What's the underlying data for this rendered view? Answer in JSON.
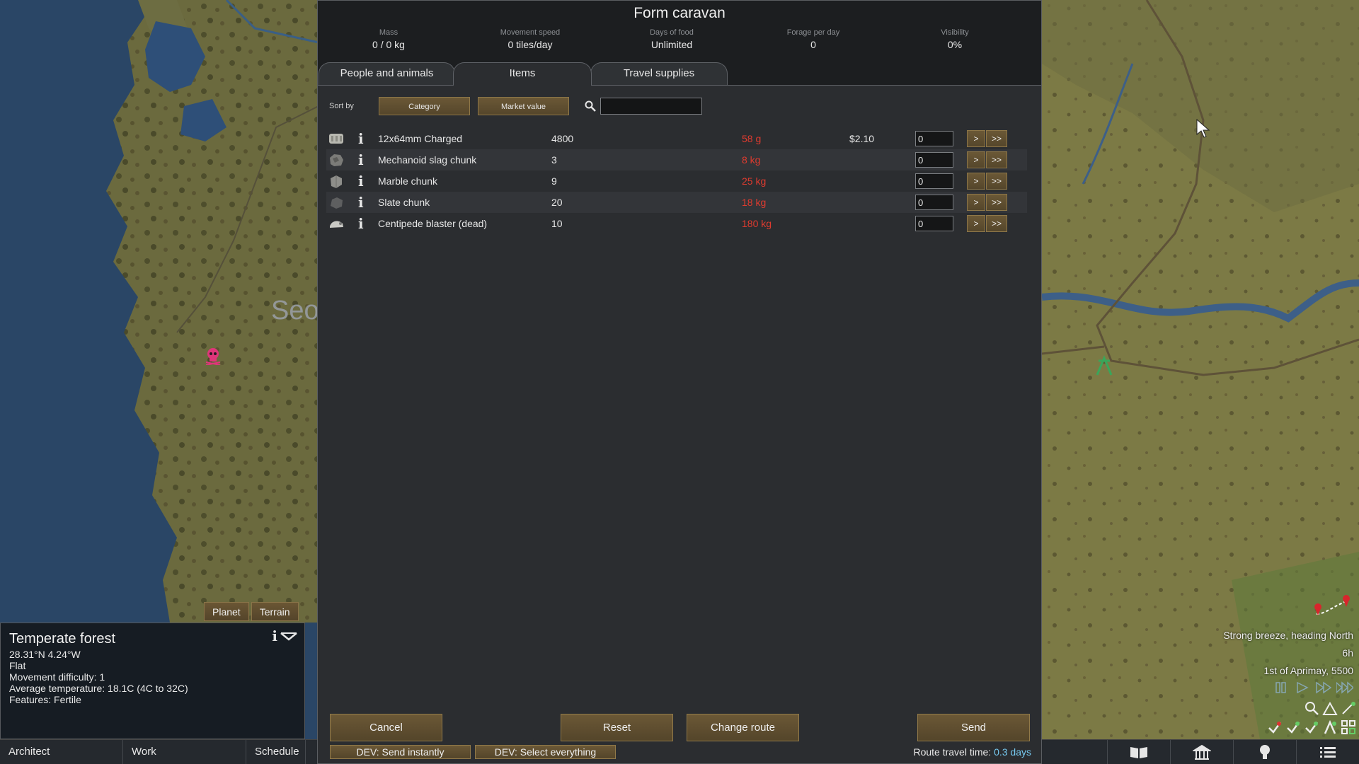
{
  "dialog": {
    "title": "Form caravan",
    "stats": [
      {
        "label": "Mass",
        "value": "0 / 0 kg"
      },
      {
        "label": "Movement speed",
        "value": "0 tiles/day"
      },
      {
        "label": "Days of food",
        "value": "Unlimited"
      },
      {
        "label": "Forage per day",
        "value": "0"
      },
      {
        "label": "Visibility",
        "value": "0%"
      }
    ],
    "tabs": [
      {
        "label": "People and animals",
        "active": false
      },
      {
        "label": "Items",
        "active": true
      },
      {
        "label": "Travel supplies",
        "active": false
      }
    ],
    "sort": {
      "label": "Sort by",
      "primary": "Category",
      "secondary": "Market value",
      "search_value": ""
    },
    "items": [
      {
        "icon": "ammo-icon",
        "name": "12x64mm Charged",
        "count": "4800",
        "mass": "58 g",
        "value": "$2.10",
        "qty": "0"
      },
      {
        "icon": "slag-chunk-icon",
        "name": "Mechanoid slag chunk",
        "count": "3",
        "mass": "8 kg",
        "value": "",
        "qty": "0"
      },
      {
        "icon": "marble-chunk-icon",
        "name": "Marble chunk",
        "count": "9",
        "mass": "25 kg",
        "value": "",
        "qty": "0"
      },
      {
        "icon": "slate-chunk-icon",
        "name": "Slate chunk",
        "count": "20",
        "mass": "18 kg",
        "value": "",
        "qty": "0"
      },
      {
        "icon": "centipede-corpse-icon",
        "name": "Centipede blaster (dead)",
        "count": "10",
        "mass": "180 kg",
        "value": "",
        "qty": "0"
      }
    ],
    "buttons": {
      "info": "i",
      "add_one": ">",
      "add_all": ">>",
      "cancel": "Cancel",
      "reset": "Reset",
      "change_route": "Change route",
      "send": "Send",
      "dev_send": "DEV: Send instantly",
      "dev_select": "DEV: Select everything"
    },
    "route": {
      "label": "Route travel time:",
      "value": "0.3 days"
    }
  },
  "tile_info": {
    "tabs": [
      "Planet",
      "Terrain"
    ],
    "biome": "Temperate forest",
    "coords": "28.31°N 4.24°W",
    "terrain": "Flat",
    "movement": "Movement difficulty: 1",
    "temperature": "Average temperature: 18.1C (4C to 32C)",
    "features": "Features: Fertile",
    "info_button": "i"
  },
  "map": {
    "label_fragment": "Seo"
  },
  "weather": {
    "wind": "Strong breeze, heading North",
    "hour": "6h",
    "date": "1st of Aprimay, 5500"
  },
  "main_tabs": [
    "Architect",
    "Work",
    "Schedule"
  ],
  "main_icons": [
    "history-book-icon",
    "factions-icon",
    "ideas-lightbulb-icon",
    "menu-list-icon"
  ],
  "colors": {
    "accent_button": "#5f4e30",
    "mass_red": "#e03b2f",
    "route_blue": "#76c9f0",
    "faction_icon_red": "#e0357a",
    "settlement_green": "#3aa65a"
  }
}
